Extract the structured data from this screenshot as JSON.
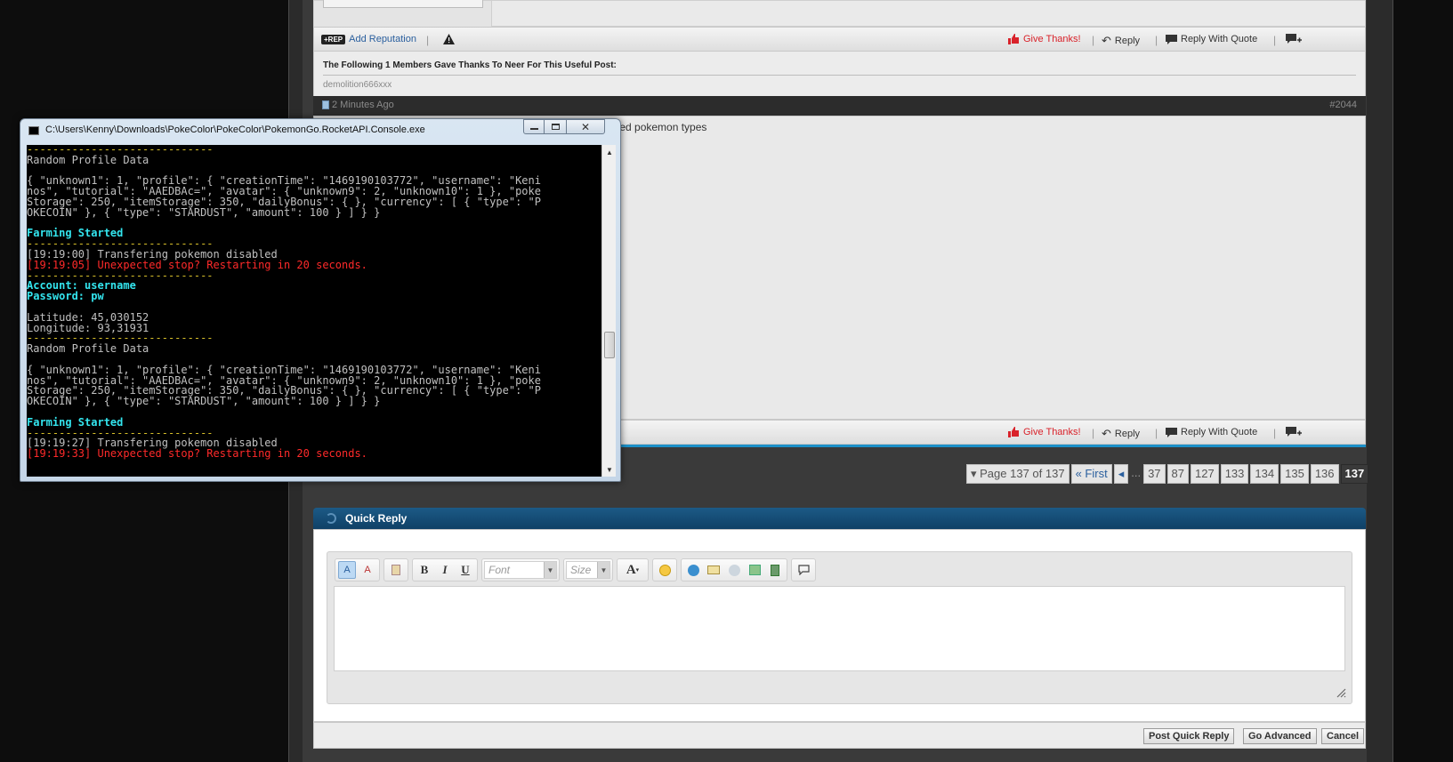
{
  "forum": {
    "action_bar": {
      "rep_badge": "+REP",
      "add_reputation": "Add Reputation",
      "give_thanks": "Give Thanks!",
      "reply": "Reply",
      "reply_with_quote": "Reply With Quote"
    },
    "thanks": {
      "title": "The Following 1 Members Gave Thanks To Neer For This Useful Post:",
      "user": "demolition666xxx"
    },
    "post": {
      "time": "2 Minutes Ago",
      "number": "#2044",
      "text_fragment": "ted pokemon types"
    },
    "pagination": {
      "page_label": "Page 137 of 137",
      "first": "First",
      "dots": "...",
      "pages": [
        "37",
        "87",
        "127",
        "133",
        "134",
        "135",
        "136"
      ],
      "current": "137"
    },
    "quick_reply": {
      "title": "Quick Reply",
      "font_placeholder": "Font",
      "size_placeholder": "Size",
      "post_button": "Post Quick Reply",
      "advanced_button": "Go Advanced",
      "cancel_button": "Cancel"
    }
  },
  "console": {
    "title": "C:\\Users\\Kenny\\Downloads\\PokeColor\\PokeColor\\PokemonGo.RocketAPI.Console.exe",
    "lines": [
      {
        "t": "-----------------------------",
        "c": "yellow"
      },
      {
        "t": "Random Profile Data",
        "c": "gray"
      },
      {
        "t": "",
        "c": "gray"
      },
      {
        "t": "{ \"unknown1\": 1, \"profile\": { \"creationTime\": \"1469190103772\", \"username\": \"Keni",
        "c": "gray"
      },
      {
        "t": "nos\", \"tutorial\": \"AAEDBAc=\", \"avatar\": { \"unknown9\": 2, \"unknown10\": 1 }, \"poke",
        "c": "gray"
      },
      {
        "t": "Storage\": 250, \"itemStorage\": 350, \"dailyBonus\": { }, \"currency\": [ { \"type\": \"P",
        "c": "gray"
      },
      {
        "t": "OKECOIN\" }, { \"type\": \"STARDUST\", \"amount\": 100 } ] } }",
        "c": "gray"
      },
      {
        "t": "",
        "c": "gray"
      },
      {
        "t": "Farming Started",
        "c": "cyan"
      },
      {
        "t": "-----------------------------",
        "c": "yellow"
      },
      {
        "t": "[19:19:00] Transfering pokemon disabled",
        "c": "gray"
      },
      {
        "t": "[19:19:05] Unexpected stop? Restarting in 20 seconds.",
        "c": "red"
      },
      {
        "t": "-----------------------------",
        "c": "yellow"
      },
      {
        "t": "Account: username",
        "c": "cyan"
      },
      {
        "t": "Password: pw",
        "c": "cyan"
      },
      {
        "t": "",
        "c": "gray"
      },
      {
        "t": "Latitude: 45,030152",
        "c": "gray"
      },
      {
        "t": "Longitude: 93,31931",
        "c": "gray"
      },
      {
        "t": "-----------------------------",
        "c": "yellow"
      },
      {
        "t": "Random Profile Data",
        "c": "gray"
      },
      {
        "t": "",
        "c": "gray"
      },
      {
        "t": "{ \"unknown1\": 1, \"profile\": { \"creationTime\": \"1469190103772\", \"username\": \"Keni",
        "c": "gray"
      },
      {
        "t": "nos\", \"tutorial\": \"AAEDBAc=\", \"avatar\": { \"unknown9\": 2, \"unknown10\": 1 }, \"poke",
        "c": "gray"
      },
      {
        "t": "Storage\": 250, \"itemStorage\": 350, \"dailyBonus\": { }, \"currency\": [ { \"type\": \"P",
        "c": "gray"
      },
      {
        "t": "OKECOIN\" }, { \"type\": \"STARDUST\", \"amount\": 100 } ] } }",
        "c": "gray"
      },
      {
        "t": "",
        "c": "gray"
      },
      {
        "t": "Farming Started",
        "c": "cyan"
      },
      {
        "t": "-----------------------------",
        "c": "yellow"
      },
      {
        "t": "[19:19:27] Transfering pokemon disabled",
        "c": "gray"
      },
      {
        "t": "[19:19:33] Unexpected stop? Restarting in 20 seconds.",
        "c": "red"
      }
    ]
  }
}
